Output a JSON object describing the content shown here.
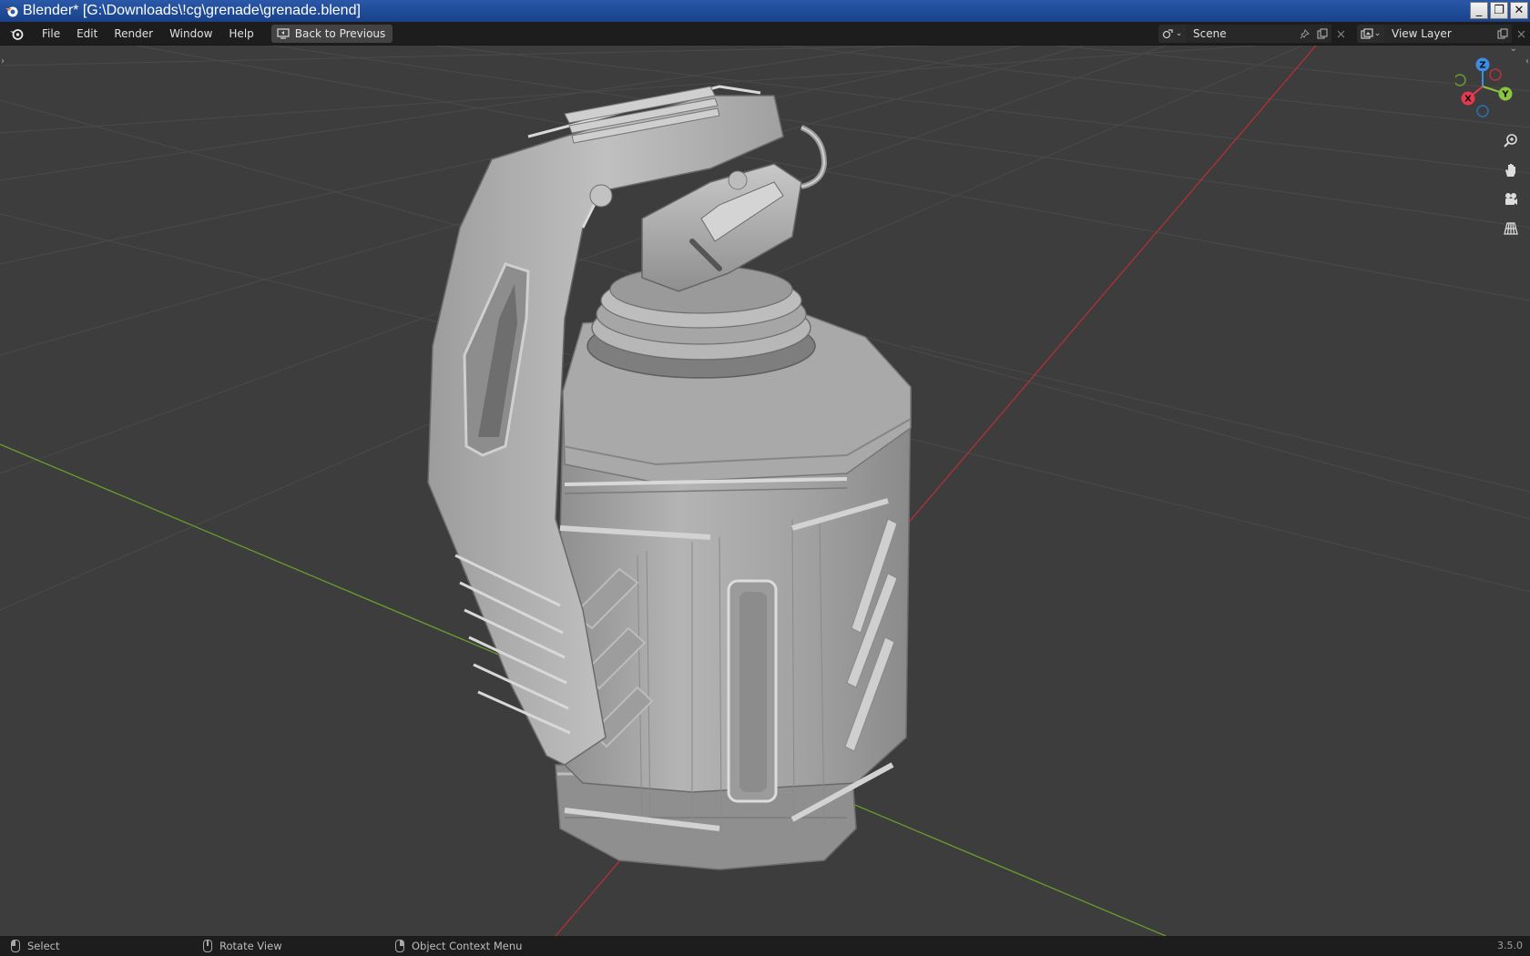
{
  "window": {
    "title": "Blender* [G:\\Downloads\\!cg\\grenade\\grenade.blend]",
    "controls": {
      "minimize": "_",
      "restore": "❐",
      "close": "✕"
    }
  },
  "menubar": {
    "items": [
      "File",
      "Edit",
      "Render",
      "Window",
      "Help"
    ],
    "back_button": "Back to Previous",
    "scene": {
      "label": "Scene"
    },
    "view_layer": {
      "label": "View Layer"
    }
  },
  "gizmo": {
    "axes": {
      "x": "X",
      "y": "Y",
      "z": "Z"
    },
    "colors": {
      "x": "#e8384f",
      "y": "#8bc43f",
      "z": "#3b8ee8"
    }
  },
  "viewport": {
    "colors": {
      "background": "#3d3d3d",
      "grid": "#555555",
      "x_axis": "#c0303a",
      "y_axis": "#6a9c2c",
      "model": "#a9a9a9"
    }
  },
  "statusbar": {
    "select": "Select",
    "rotate": "Rotate View",
    "context": "Object Context Menu",
    "version": "3.5.0"
  }
}
